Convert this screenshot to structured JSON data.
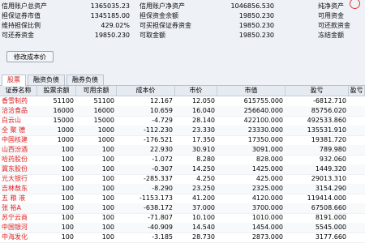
{
  "summary": {
    "rows": [
      {
        "l1": "信用账户总资产",
        "v1": "1365035.23",
        "l2": "信用账户净资产",
        "v2": "1046856.530",
        "l3": "纯净资产"
      },
      {
        "l1": "担保证券市值",
        "v1": "1345185.00",
        "l2": "担保资金余额",
        "v2": "19850.230",
        "l3": "可用资金"
      },
      {
        "l1": "维持担保比例",
        "v1": "429.02%",
        "l2": "可买担保证券资金",
        "v2": "19850.230",
        "l3": "可还款资金"
      },
      {
        "l1": "可还券资金",
        "v1": "19850.230",
        "l2": "可取金额",
        "v2": "19850.230",
        "l3": "冻结金额"
      }
    ]
  },
  "buttons": {
    "change_cost": "修改成本价"
  },
  "tabs": [
    "股票",
    "融资负债",
    "融券负债"
  ],
  "columns": [
    "证券名称",
    "股票余额",
    "可用余额",
    "成本价",
    "市价",
    "市值",
    "盈亏",
    "盈亏"
  ],
  "holdings": [
    {
      "name": "香雪制药",
      "balance": "51100",
      "avail": "51100",
      "cost": "12.167",
      "price": "12.050",
      "value": "615755.000",
      "pl": "-6812.710"
    },
    {
      "name": "洽洽食品",
      "balance": "16000",
      "avail": "16000",
      "cost": "10.659",
      "price": "16.040",
      "value": "256640.000",
      "pl": "85756.020"
    },
    {
      "name": "白云山",
      "balance": "15000",
      "avail": "15000",
      "cost": "-4.729",
      "price": "28.140",
      "value": "422100.000",
      "pl": "492533.860"
    },
    {
      "name": "全 聚 德",
      "balance": "1000",
      "avail": "1000",
      "cost": "-112.230",
      "price": "23.330",
      "value": "23330.000",
      "pl": "135531.910"
    },
    {
      "name": "中国核建",
      "balance": "1000",
      "avail": "1000",
      "cost": "-176.521",
      "price": "17.350",
      "value": "17350.000",
      "pl": "19381.720"
    },
    {
      "name": "山西汾酒",
      "balance": "100",
      "avail": "100",
      "cost": "22.930",
      "price": "30.910",
      "value": "3091.000",
      "pl": "789.980"
    },
    {
      "name": "哈药股份",
      "balance": "100",
      "avail": "100",
      "cost": "-1.072",
      "price": "8.280",
      "value": "828.000",
      "pl": "932.060"
    },
    {
      "name": "冀东股份",
      "balance": "100",
      "avail": "100",
      "cost": "-0.307",
      "price": "14.250",
      "value": "1425.000",
      "pl": "1449.320"
    },
    {
      "name": "光大银行",
      "balance": "100",
      "avail": "100",
      "cost": "-285.337",
      "price": "4.250",
      "value": "425.000",
      "pl": "29013.310"
    },
    {
      "name": "吉林敖东",
      "balance": "100",
      "avail": "100",
      "cost": "-8.290",
      "price": "23.250",
      "value": "2325.000",
      "pl": "3154.290"
    },
    {
      "name": "五 粮 液",
      "balance": "100",
      "avail": "100",
      "cost": "-1153.173",
      "price": "41.200",
      "value": "4120.000",
      "pl": "119414.000"
    },
    {
      "name": "张 裕A",
      "balance": "100",
      "avail": "100",
      "cost": "-638.172",
      "price": "37.000",
      "value": "3700.000",
      "pl": "67508.660"
    },
    {
      "name": "苏宁云商",
      "balance": "100",
      "avail": "100",
      "cost": "-71.807",
      "price": "10.100",
      "value": "1010.000",
      "pl": "8191.000"
    },
    {
      "name": "中国银河",
      "balance": "100",
      "avail": "100",
      "cost": "-40.909",
      "price": "14.540",
      "value": "1454.000",
      "pl": "5545.000"
    },
    {
      "name": "中海发化",
      "balance": "100",
      "avail": "100",
      "cost": "-3.185",
      "price": "28.730",
      "value": "2873.000",
      "pl": "3177.660"
    }
  ]
}
